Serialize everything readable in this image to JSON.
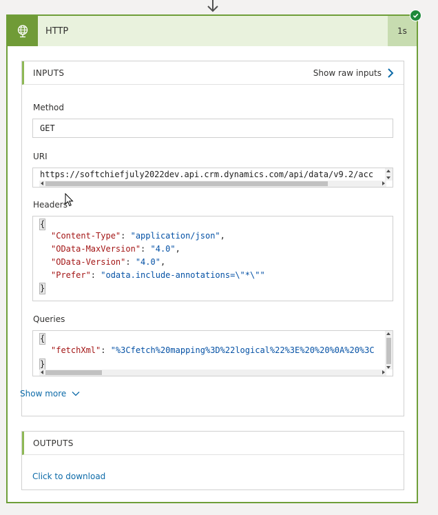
{
  "action": {
    "title": "HTTP",
    "duration": "1s",
    "header_icon": "globe-icon",
    "status_icon": "checkmark-icon",
    "colors": {
      "accent": "#709b37",
      "header_bg": "#e9f2dd",
      "success": "#1f8a3b",
      "link": "#0c6aa8"
    }
  },
  "inputs": {
    "title": "INPUTS",
    "raw_link": "Show raw inputs",
    "method_label": "Method",
    "method_value": "GET",
    "uri_label": "URI",
    "uri_value": "https://softchiefjuly2022dev.api.crm.dynamics.com/api/data/v9.2/acc",
    "headers_label": "Headers",
    "headers": [
      {
        "key": "\"Content-Type\"",
        "value": "\"application/json\"",
        "trail": ","
      },
      {
        "key": "\"OData-MaxVersion\"",
        "value": "\"4.0\"",
        "trail": ","
      },
      {
        "key": "\"OData-Version\"",
        "value": "\"4.0\"",
        "trail": ","
      },
      {
        "key": "\"Prefer\"",
        "value": "\"odata.include-annotations=\\\"*\\\"\"",
        "trail": ""
      }
    ],
    "queries_label": "Queries",
    "queries": [
      {
        "key": "\"fetchXml\"",
        "value": "\"%3Cfetch%20mapping%3D%22logical%22%3E%20%20%0A%20%3C"
      }
    ],
    "brace_open": "{",
    "brace_close": "}",
    "show_more": "Show more"
  },
  "outputs": {
    "title": "OUTPUTS",
    "download_link": "Click to download"
  }
}
